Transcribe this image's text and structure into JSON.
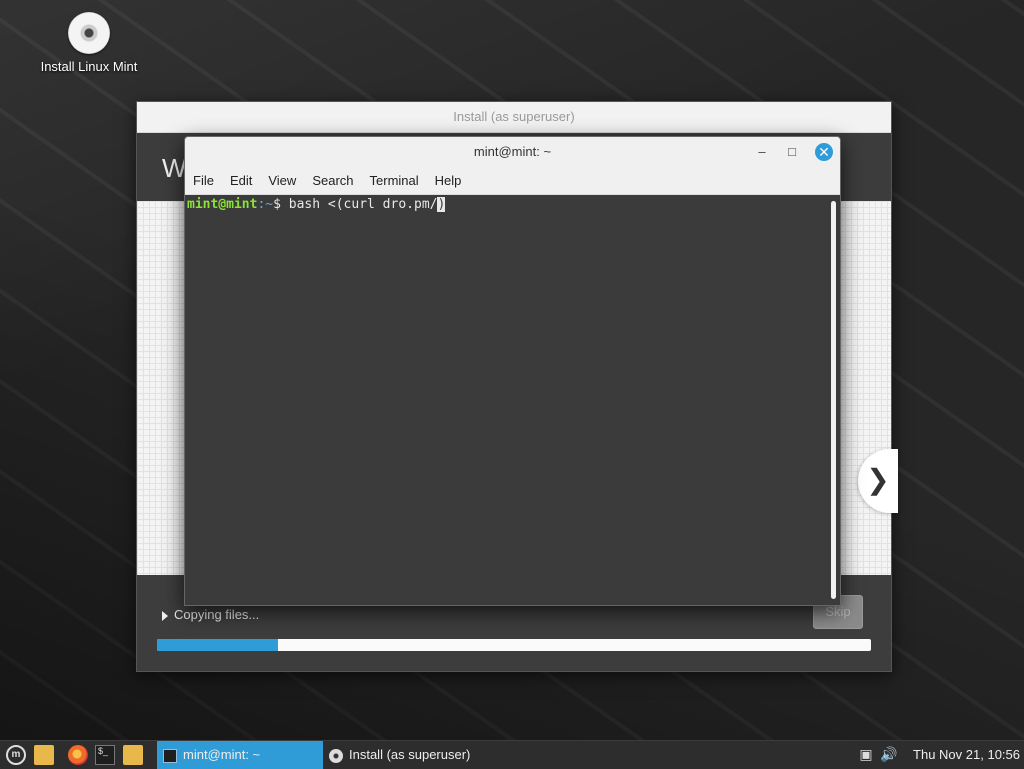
{
  "desktop": {
    "icon_label": "Install Linux Mint",
    "icon_name": "disc-icon"
  },
  "installer": {
    "title": "Install (as superuser)",
    "header_text": "W",
    "next_arrow": "❯",
    "status_text": "Copying files...",
    "skip_label": "Skip",
    "progress_percent": 17
  },
  "terminal": {
    "title": "mint@mint: ~",
    "menu": [
      "File",
      "Edit",
      "View",
      "Search",
      "Terminal",
      "Help"
    ],
    "prompt_user": "mint@mint",
    "prompt_path": ":~",
    "prompt_symbol": "$ ",
    "command": "bash <(curl dro.pm/",
    "cursor_char": ")",
    "controls": {
      "minimize": "–",
      "maximize": "□",
      "close": "✕"
    }
  },
  "taskbar": {
    "tasks": [
      {
        "label": "mint@mint: ~",
        "active": true
      },
      {
        "label": "Install (as superuser)",
        "active": false
      }
    ],
    "clock": "Thu Nov 21, 10:56"
  },
  "colors": {
    "accent": "#2f9bd7",
    "prompt_user": "#8ae234",
    "prompt_path": "#729fcf"
  }
}
